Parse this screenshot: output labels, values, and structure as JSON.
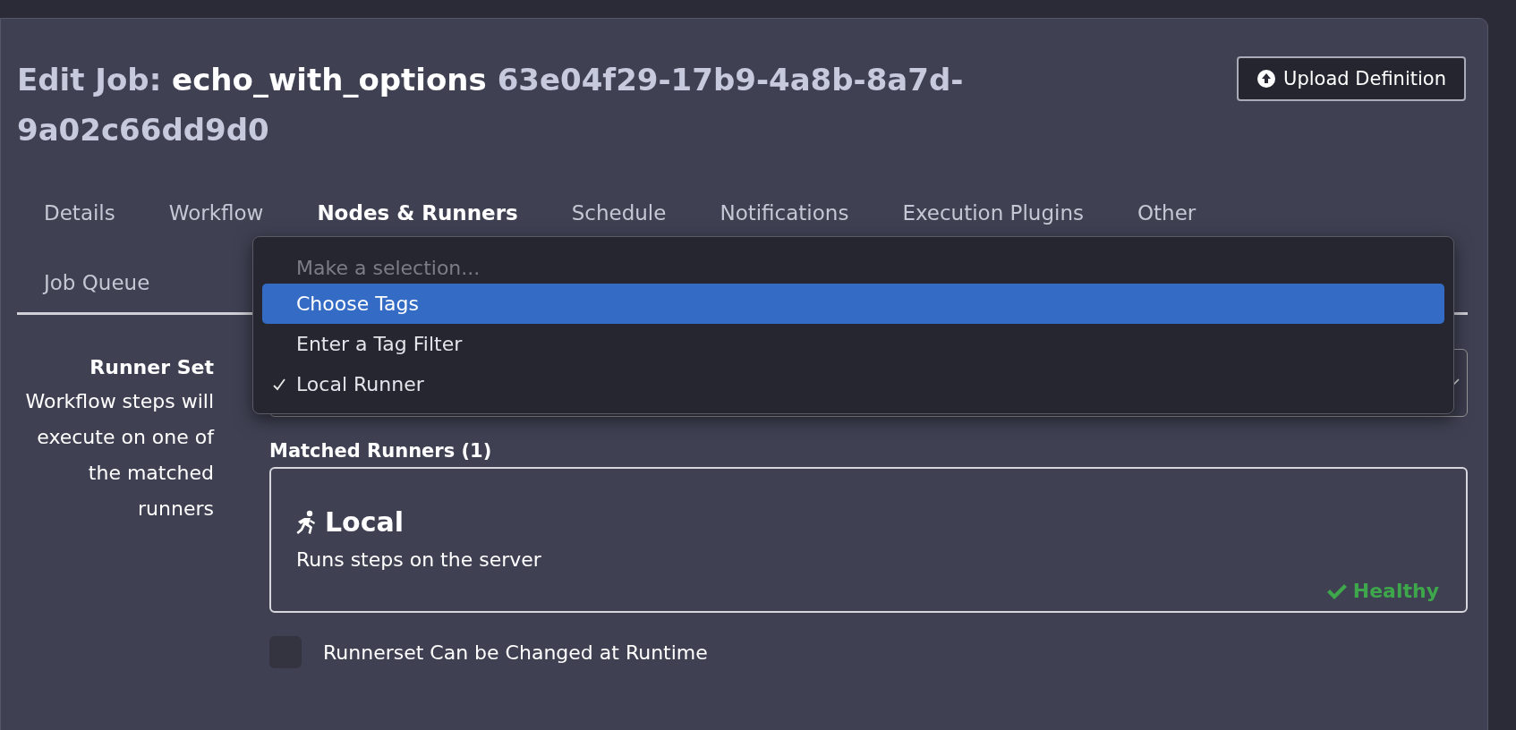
{
  "header": {
    "title_prefix": "Edit Job:",
    "job_name": "echo_with_options",
    "job_id": "63e04f29-17b9-4a8b-8a7d-9a02c66dd9d0",
    "upload_button": "Upload Definition"
  },
  "tabs": [
    {
      "label": "Details",
      "selected": false
    },
    {
      "label": "Workflow",
      "selected": false
    },
    {
      "label": "Nodes & Runners",
      "selected": true
    },
    {
      "label": "Schedule",
      "selected": false
    },
    {
      "label": "Notifications",
      "selected": false
    },
    {
      "label": "Execution Plugins",
      "selected": false
    },
    {
      "label": "Other",
      "selected": false
    },
    {
      "label": "Job Queue",
      "selected": false
    }
  ],
  "runner_set": {
    "label": "Runner Set",
    "description": "Workflow steps will execute on one of the matched runners"
  },
  "dropdown_menu": {
    "items": [
      {
        "label": "Make a selection...",
        "disabled": true,
        "highlighted": false,
        "checked": false
      },
      {
        "label": "Choose Tags",
        "disabled": false,
        "highlighted": true,
        "checked": false
      },
      {
        "label": "Enter a Tag Filter",
        "disabled": false,
        "highlighted": false,
        "checked": false
      },
      {
        "label": "Local Runner",
        "disabled": false,
        "highlighted": false,
        "checked": true
      }
    ]
  },
  "matched_runners": {
    "heading": "Matched Runners (1)",
    "runners": [
      {
        "name": "Local",
        "description": "Runs steps on the server",
        "status": "Healthy"
      }
    ]
  },
  "runtime_change": {
    "label": "Runnerset Can be Changed at Runtime",
    "checked": false
  }
}
